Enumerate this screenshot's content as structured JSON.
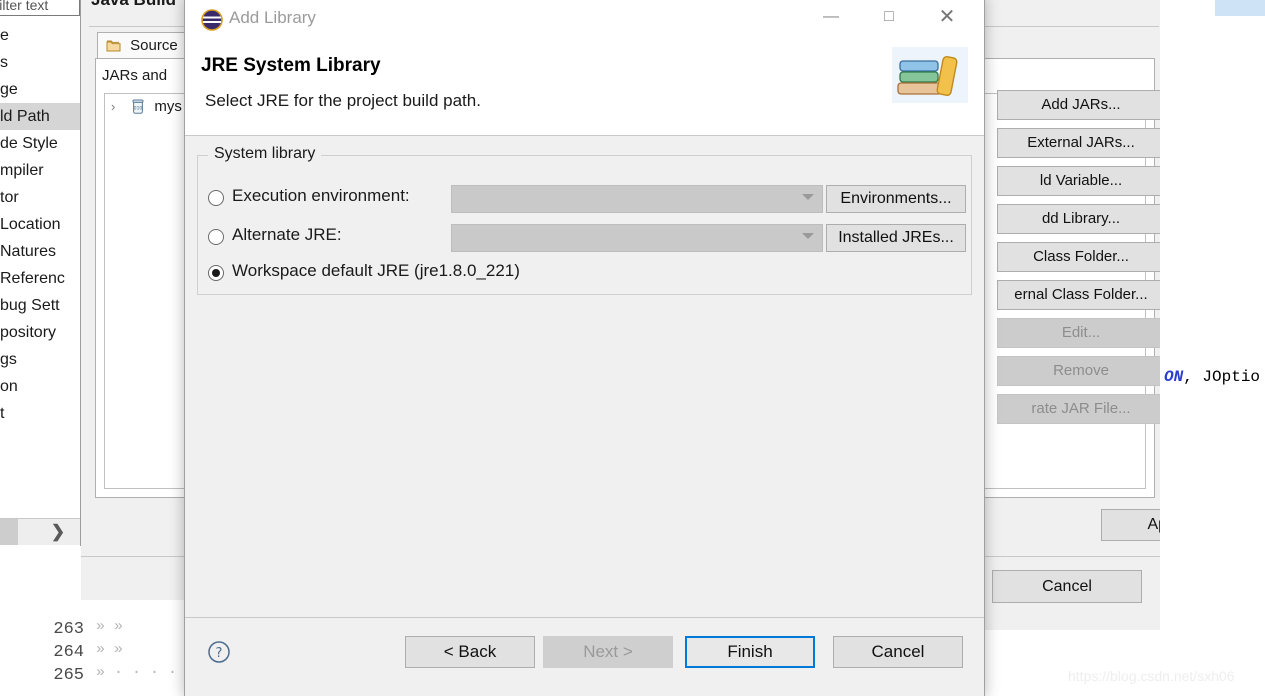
{
  "background": {
    "window_title": "Java Build",
    "sidebar": {
      "filter_placeholder": "type filter text",
      "items": [
        {
          "label": "e",
          "selected": false
        },
        {
          "label": "s",
          "selected": false
        },
        {
          "label": "ge",
          "selected": false
        },
        {
          "label": "ld Path",
          "selected": true
        },
        {
          "label": "de Style",
          "selected": false
        },
        {
          "label": "mpiler",
          "selected": false
        },
        {
          "label": "tor",
          "selected": false
        },
        {
          "label": "Location",
          "selected": false
        },
        {
          "label": "Natures",
          "selected": false
        },
        {
          "label": "Referenc",
          "selected": false
        },
        {
          "label": "bug Sett",
          "selected": false
        },
        {
          "label": "pository",
          "selected": false
        },
        {
          "label": "gs",
          "selected": false
        },
        {
          "label": "on",
          "selected": false
        },
        {
          "label": "t",
          "selected": false
        }
      ],
      "scroll_right_icon": "chevron-right-icon"
    },
    "tabs": [
      {
        "label": "Source",
        "icon": "source-folder-icon",
        "active": true
      }
    ],
    "tab_body_label": "JARs and",
    "jar_rows": [
      {
        "label": "mys",
        "icon": "jar-icon",
        "twisty": "›"
      }
    ],
    "side_buttons": [
      {
        "label": "Add JARs...",
        "disabled": false
      },
      {
        "label": "External JARs...",
        "disabled": false
      },
      {
        "label": "ld Variable...",
        "disabled": false
      },
      {
        "label": "dd Library...",
        "disabled": false
      },
      {
        "label": "Class Folder...",
        "disabled": false
      },
      {
        "label": "ernal Class Folder...",
        "disabled": false
      },
      {
        "label": "Edit...",
        "disabled": true
      },
      {
        "label": "Remove",
        "disabled": true
      },
      {
        "label": "rate JAR File...",
        "disabled": true
      }
    ],
    "apply_label": "Apply",
    "cancel_label": "Cancel"
  },
  "editor": {
    "line_numbers": [
      "263",
      "264",
      "265"
    ],
    "indent_marks": [
      "»          »",
      "»          »",
      "»        · · · ·"
    ],
    "code_fragment_kw": "ON",
    "code_fragment_rest": ", JOptio",
    "watermark": "https://blog.csdn.net/sxh06"
  },
  "dialog": {
    "title": "Add Library",
    "title_icon": "eclipse-icon",
    "window_buttons": {
      "minimize": "—",
      "maximize": "□",
      "close": "✕"
    },
    "header": {
      "title": "JRE System Library",
      "subtitle": "Select JRE for the project build path.",
      "icon": "books-icon"
    },
    "group": {
      "legend": "System library",
      "options": [
        {
          "label": "Execution environment:",
          "selected": false,
          "control": "combo",
          "combo_value": "",
          "button": "Environments..."
        },
        {
          "label": "Alternate JRE:",
          "selected": false,
          "control": "combo",
          "combo_value": "",
          "button": "Installed JREs..."
        },
        {
          "label": "Workspace default JRE (jre1.8.0_221)",
          "selected": true,
          "control": "none",
          "combo_value": "",
          "button": ""
        }
      ]
    },
    "footer": {
      "help_icon": "help-question-icon",
      "buttons": [
        {
          "label": "< Back",
          "disabled": false,
          "default": false
        },
        {
          "label": "Next >",
          "disabled": true,
          "default": false
        },
        {
          "label": "Finish",
          "disabled": false,
          "default": true
        },
        {
          "label": "Cancel",
          "disabled": false,
          "default": false
        }
      ]
    }
  },
  "colors": {
    "accent": "#0078d7",
    "dialog_bg": "#f0f0f0",
    "button_bg": "#e1e1e1",
    "selection": "#d5d5d5"
  }
}
